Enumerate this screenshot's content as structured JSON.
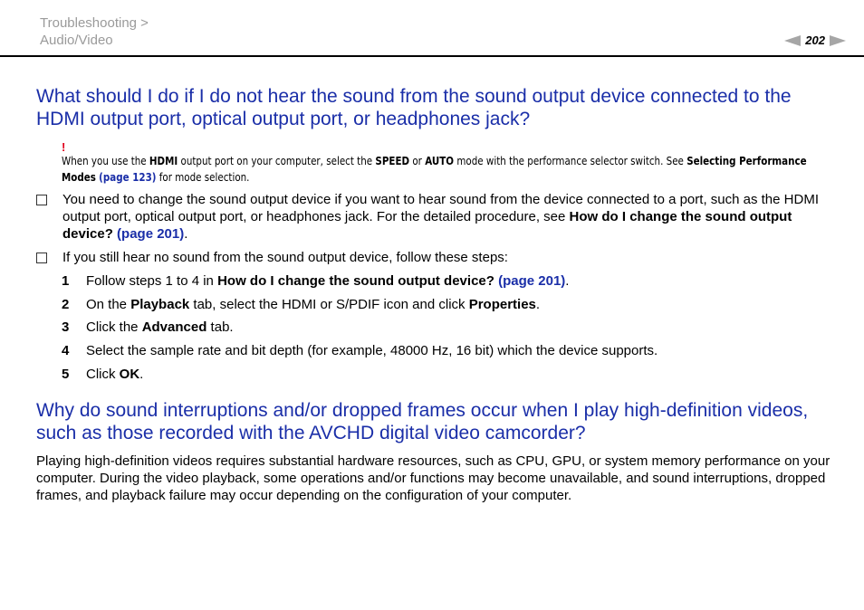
{
  "header": {
    "breadcrumb_line1": "Troubleshooting >",
    "breadcrumb_line2": "Audio/Video",
    "page_number": "202"
  },
  "section1": {
    "heading": "What should I do if I do not hear the sound from the sound output device connected to the HDMI output port, optical output port, or headphones jack?",
    "note": {
      "mark": "!",
      "t1": "When you use the ",
      "b1": "HDMI",
      "t2": " output port on your computer, select the ",
      "b2": "SPEED",
      "t3": " or ",
      "b3": "AUTO",
      "t4": " mode with the performance selector switch. See ",
      "b4": "Selecting Performance Modes",
      "link": "(page 123)",
      "t5": " for mode selection."
    },
    "bullet1": {
      "t1": "You need to change the sound output device if you want to hear sound from the device connected to a port, such as the HDMI output port, optical output port, or headphones jack. For the detailed procedure, see ",
      "b1": "How do I change the sound output device?",
      "link": "(page 201)",
      "t2": "."
    },
    "bullet2": {
      "text": "If you still hear no sound from the sound output device, follow these steps:"
    },
    "steps": [
      {
        "num": "1",
        "t1": "Follow steps 1 to 4 in ",
        "b1": "How do I change the sound output device?",
        "link": "(page 201)",
        "t2": "."
      },
      {
        "num": "2",
        "t1": "On the ",
        "b1": "Playback",
        "t2": " tab, select the HDMI or S/PDIF icon and click ",
        "b2": "Properties",
        "t3": "."
      },
      {
        "num": "3",
        "t1": "Click the ",
        "b1": "Advanced",
        "t2": " tab."
      },
      {
        "num": "4",
        "t1": "Select the sample rate and bit depth (for example, 48000 Hz, 16 bit) which the device supports."
      },
      {
        "num": "5",
        "t1": "Click ",
        "b1": "OK",
        "t2": "."
      }
    ]
  },
  "section2": {
    "heading": "Why do sound interruptions and/or dropped frames occur when I play high-definition videos, such as those recorded with the AVCHD digital video camcorder?",
    "body": "Playing high-definition videos requires substantial hardware resources, such as CPU, GPU, or system memory performance on your computer. During the video playback, some operations and/or functions may become unavailable, and sound interruptions, dropped frames, and playback failure may occur depending on the configuration of your computer."
  },
  "colors": {
    "heading_blue": "#1a2ea8",
    "warning_red": "#e0001a",
    "breadcrumb_gray": "#9a9a9a"
  }
}
